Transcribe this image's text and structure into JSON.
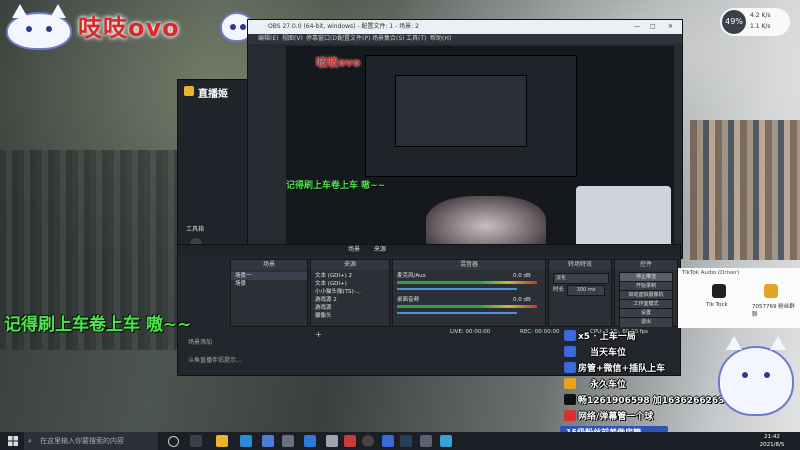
{
  "overlay": {
    "streamer_name": "吱吱ovo",
    "caption_large": "记得刷上车卷上车 嗷~~",
    "caption_inner": "记得刷上车卷上车 嗷~~"
  },
  "obs": {
    "title": "OBS 27.0.0 (64-bit, windows) - 配置文件: 1 - 场景: 2",
    "menu": [
      "编辑(E)",
      "视图(V)",
      "停靠窗口(D)",
      "配置文件(P)",
      "场景集合(S)",
      "工具(T)",
      "帮助(H)"
    ],
    "scenes_header": "场景",
    "scenes": [
      "场景一",
      "场景"
    ],
    "sources_header": "来源",
    "sources": [
      "文本 (GDI+) 2",
      "文本 (GDI+)",
      "小小猫头咖(TS)-...",
      "游戏源 2",
      "游戏源",
      "摄像头"
    ],
    "mixer_header": "混音器",
    "mixer": [
      {
        "label": "麦克风/Aux",
        "db": "0.0 dB"
      },
      {
        "label": "桌面音频",
        "db": "0.0 dB"
      }
    ],
    "transitions_header": "转场特效",
    "transition_type": "淡化",
    "duration_label": "时长",
    "duration_value": "300 ms",
    "controls_header": "控件",
    "controls": [
      "停止推流",
      "开始录制",
      "启动虚拟摄像机",
      "工作室模式",
      "设置",
      "退出"
    ],
    "scene_tab": "场景",
    "sources_tab": "来源",
    "status": {
      "live": "LIVE: 00:00:00",
      "rec": "REC: 00:00:00",
      "cpu": "CPU: 3.1%, 60.00 fps"
    }
  },
  "livehime": {
    "title": "直播姬",
    "tools_label": "工具箱",
    "footer_left": "场景添加",
    "footer_notice": "斗鱼直播伴侣提示..."
  },
  "network": {
    "percent": "49%",
    "up": "4.2 K/s",
    "down": "1.1 K/s"
  },
  "music": {
    "title": "TikTok Audio (Driver)",
    "items": [
      "Tik Tock",
      "7057769 粉丝群聊"
    ]
  },
  "info_list": [
    {
      "text": "x5 · 上车一局",
      "color": "#3a6ad8"
    },
    {
      "text": "当天车位",
      "color": "#3a6ad8"
    },
    {
      "text": "房管+微信+插队上车",
      "color": "#3a6ad8"
    },
    {
      "text": "永久车位",
      "color": "#e6a21c"
    },
    {
      "text": "畅1261906598 加1636266263",
      "color": "#111111"
    },
    {
      "text": "网络/弹幕管一个球",
      "color": "#d83030"
    }
  ],
  "info_badge": "15级粉丝前差做房管",
  "taskbar": {
    "search_placeholder": "在这里输入你要搜索的内容",
    "time": "21:42",
    "date": "2021/8/5"
  }
}
